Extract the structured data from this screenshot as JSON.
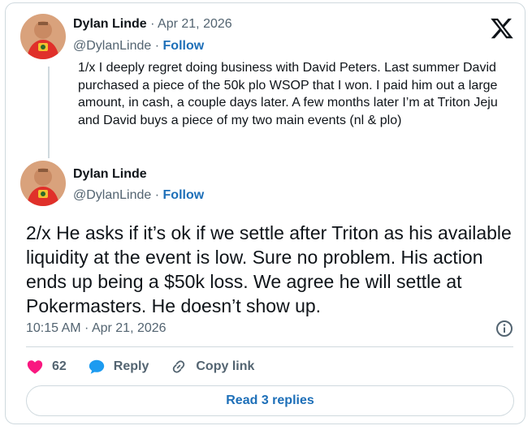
{
  "tweet1": {
    "name": "Dylan Linde",
    "date_sep": " · ",
    "date": "Apr 21, 2026",
    "handle": "@DylanLinde",
    "follow_sep": " · ",
    "follow_label": "Follow",
    "text": "1/x I deeply regret doing business with David Peters.   Last summer David purchased a piece of the 50k plo WSOP that I won.  I paid him out a large amount, in cash, a couple days later.  A few months later I’m at Triton Jeju and David buys a piece of my two main events (nl & plo)"
  },
  "tweet2": {
    "name": "Dylan Linde",
    "handle": "@DylanLinde",
    "follow_sep": " · ",
    "follow_label": "Follow",
    "text": "2/x He asks if it’s ok if we settle after Triton as his available liquidity at the event is low.  Sure no problem.   His action ends up being a $50k loss.   We agree he will settle at Pokermasters.   He doesn’t show up.",
    "timestamp": "10:15 AM · Apr 21, 2026"
  },
  "actions": {
    "like_count": "62",
    "reply_label": "Reply",
    "copy_label": "Copy link"
  },
  "read_replies_label": "Read 3 replies",
  "colors": {
    "like": "#f91880",
    "reply": "#1d9bf0",
    "link": "#1d6fb8",
    "border": "#cfd9de",
    "muted": "#536471"
  },
  "icons": [
    "x-logo-icon",
    "heart-icon",
    "reply-bubble-icon",
    "link-icon",
    "info-icon"
  ]
}
